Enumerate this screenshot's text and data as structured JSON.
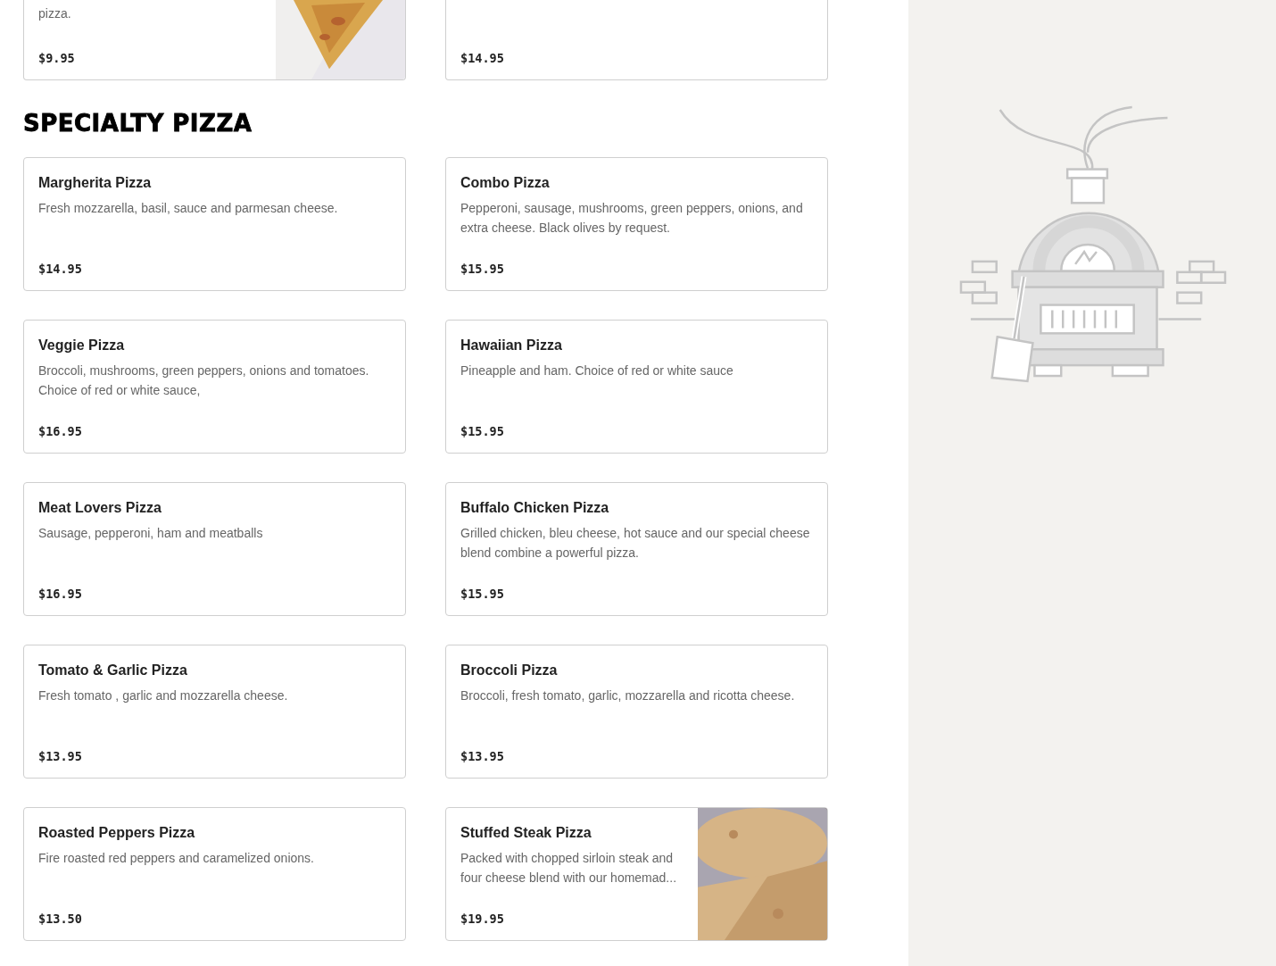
{
  "sections": [
    {
      "items": [
        {
          "description": "pizza.",
          "price": "$9.95"
        },
        {
          "price": "$14.95"
        }
      ]
    },
    {
      "title": "SPECIALTY PIZZA",
      "items": [
        {
          "name": "Margherita Pizza",
          "description": "Fresh mozzarella, basil, sauce and parmesan cheese.",
          "price": "$14.95"
        },
        {
          "name": "Combo Pizza",
          "description": "Pepperoni, sausage, mushrooms, green peppers, onions, and extra cheese. Black olives by request.",
          "price": "$15.95"
        },
        {
          "name": "Veggie Pizza",
          "description": "Broccoli, mushrooms, green peppers, onions and tomatoes. Choice of red or white sauce,",
          "price": "$16.95"
        },
        {
          "name": "Hawaiian Pizza",
          "description": "Pineapple and ham. Choice of red or white sauce",
          "price": "$15.95"
        },
        {
          "name": "Meat Lovers Pizza",
          "description": "Sausage, pepperoni, ham and meatballs",
          "price": "$16.95"
        },
        {
          "name": "Buffalo Chicken Pizza",
          "description": "Grilled chicken, bleu cheese, hot sauce and our special cheese blend combine a powerful pizza.",
          "price": "$15.95"
        },
        {
          "name": "Tomato & Garlic Pizza",
          "description": "Fresh tomato , garlic and mozzarella cheese.",
          "price": "$13.95"
        },
        {
          "name": "Broccoli Pizza",
          "description": "Broccoli, fresh tomato, garlic, mozzarella and ricotta cheese.",
          "price": "$13.95"
        },
        {
          "name": "Roasted Peppers Pizza",
          "description": "Fire roasted red peppers and caramelized onions.",
          "price": "$13.50"
        },
        {
          "name": "Stuffed Steak Pizza",
          "description": "Packed with chopped sirloin steak and four cheese blend with our homemad...",
          "price": "$19.95"
        }
      ]
    }
  ]
}
